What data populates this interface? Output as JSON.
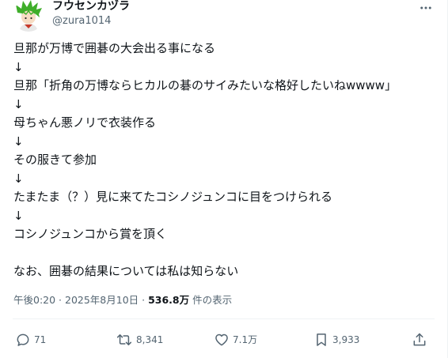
{
  "author": {
    "display_name": "フウセンカヅラ",
    "handle": "@zura1014"
  },
  "post": {
    "lines": [
      "旦那が万博で囲碁の大会出る事になる",
      "↓",
      "旦那「折角の万博ならヒカルの碁のサイみたいな格好したいねwwww」",
      "↓",
      "母ちゃん悪ノリで衣装作る",
      "↓",
      "その服きて参加",
      "↓",
      "たまたま（？）見に来てたコシノジュンコに目をつけられる",
      "↓",
      "コシノジュンコから賞を頂く",
      "",
      "なお、囲碁の結果については私は知らない"
    ]
  },
  "meta": {
    "time": "午後0:20",
    "separator": " · ",
    "date": "2025年8月10日",
    "views": "536.8万",
    "views_suffix": " 件の表示"
  },
  "actions": {
    "replies": "71",
    "reposts": "8,341",
    "likes": "7.1万",
    "bookmarks": "3,933"
  },
  "icons": {
    "more": "more-dots-icon",
    "reply": "reply-bubble-icon",
    "repost": "repost-icon",
    "like": "heart-icon",
    "bookmark": "bookmark-icon",
    "share": "share-upload-icon"
  },
  "colors": {
    "text": "#0f1419",
    "secondary": "#536471",
    "divider": "#eff3f4",
    "avatar_hair": "#3fae2a"
  }
}
